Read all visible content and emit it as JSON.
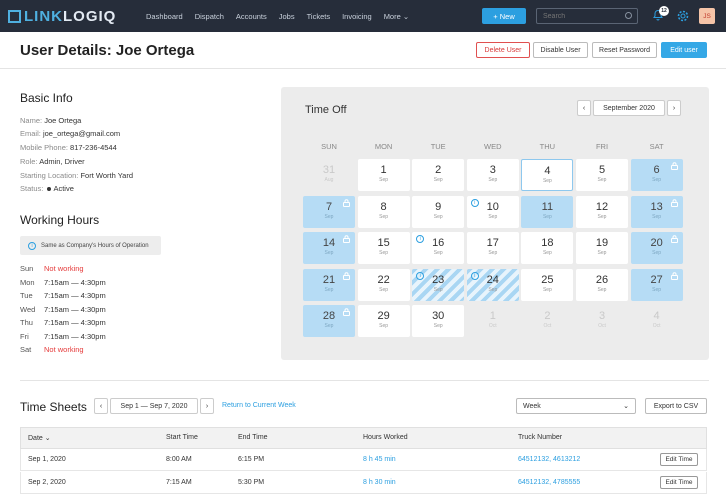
{
  "nav": {
    "logo_a": "LINK",
    "logo_b": "LOGIQ",
    "links": [
      "Dashboard",
      "Dispatch",
      "Accounts",
      "Jobs",
      "Tickets",
      "Invoicing",
      "More"
    ],
    "new_label": "+ New",
    "search_placeholder": "Search",
    "notification_count": "12",
    "avatar_initials": "JS"
  },
  "header": {
    "title": "User Details: Joe Ortega",
    "delete_label": "Delete User",
    "disable_label": "Disable User",
    "reset_label": "Reset Password",
    "edit_label": "Edit user"
  },
  "basic_info": {
    "title": "Basic Info",
    "rows": [
      {
        "label": "Name:",
        "value": "Joe Ortega"
      },
      {
        "label": "Email:",
        "value": "joe_ortega@gmail.com"
      },
      {
        "label": "Mobile Phone:",
        "value": "817-236-4544"
      },
      {
        "label": "Role:",
        "value": "Admin, Driver"
      },
      {
        "label": "Starting Location:",
        "value": "Fort Worth Yard"
      },
      {
        "label": "Status:",
        "value": "Active"
      }
    ]
  },
  "working_hours": {
    "title": "Working Hours",
    "note": "Same as Company's Hours of Operation",
    "days": [
      {
        "day": "Sun",
        "hours": "Not working",
        "off": true
      },
      {
        "day": "Mon",
        "hours": "7:15am — 4:30pm",
        "off": false
      },
      {
        "day": "Tue",
        "hours": "7:15am — 4:30pm",
        "off": false
      },
      {
        "day": "Wed",
        "hours": "7:15am — 4:30pm",
        "off": false
      },
      {
        "day": "Thu",
        "hours": "7:15am — 4:30pm",
        "off": false
      },
      {
        "day": "Fri",
        "hours": "7:15am — 4:30pm",
        "off": false
      },
      {
        "day": "Sat",
        "hours": "Not working",
        "off": true
      }
    ]
  },
  "time_off": {
    "title": "Time Off",
    "month_label": "September 2020",
    "weekdays": [
      "SUN",
      "MON",
      "TUE",
      "WED",
      "THU",
      "FRI",
      "SAT"
    ],
    "cells": [
      {
        "day": "31",
        "mon": "Aug",
        "style": "faint",
        "lock": false,
        "info": false
      },
      {
        "day": "1",
        "mon": "Sep",
        "style": "white",
        "lock": false,
        "info": false
      },
      {
        "day": "2",
        "mon": "Sep",
        "style": "white",
        "lock": false,
        "info": false
      },
      {
        "day": "3",
        "mon": "Sep",
        "style": "white",
        "lock": false,
        "info": false
      },
      {
        "day": "4",
        "mon": "Sep",
        "style": "today",
        "lock": false,
        "info": false
      },
      {
        "day": "5",
        "mon": "Sep",
        "style": "white",
        "lock": false,
        "info": false
      },
      {
        "day": "6",
        "mon": "Sep",
        "style": "blue",
        "lock": true,
        "info": false
      },
      {
        "day": "7",
        "mon": "Sep",
        "style": "blue",
        "lock": true,
        "info": false
      },
      {
        "day": "8",
        "mon": "Sep",
        "style": "white",
        "lock": false,
        "info": false
      },
      {
        "day": "9",
        "mon": "Sep",
        "style": "white",
        "lock": false,
        "info": false
      },
      {
        "day": "10",
        "mon": "Sep",
        "style": "white",
        "lock": false,
        "info": true
      },
      {
        "day": "11",
        "mon": "Sep",
        "style": "blue",
        "lock": false,
        "info": false
      },
      {
        "day": "12",
        "mon": "Sep",
        "style": "white",
        "lock": false,
        "info": false
      },
      {
        "day": "13",
        "mon": "Sep",
        "style": "blue",
        "lock": true,
        "info": false
      },
      {
        "day": "14",
        "mon": "Sep",
        "style": "blue",
        "lock": true,
        "info": false
      },
      {
        "day": "15",
        "mon": "Sep",
        "style": "white",
        "lock": false,
        "info": false
      },
      {
        "day": "16",
        "mon": "Sep",
        "style": "white",
        "lock": false,
        "info": true
      },
      {
        "day": "17",
        "mon": "Sep",
        "style": "white",
        "lock": false,
        "info": false
      },
      {
        "day": "18",
        "mon": "Sep",
        "style": "white",
        "lock": false,
        "info": false
      },
      {
        "day": "19",
        "mon": "Sep",
        "style": "white",
        "lock": false,
        "info": false
      },
      {
        "day": "20",
        "mon": "Sep",
        "style": "blue",
        "lock": true,
        "info": false
      },
      {
        "day": "21",
        "mon": "Sep",
        "style": "blue",
        "lock": true,
        "info": false
      },
      {
        "day": "22",
        "mon": "Sep",
        "style": "white",
        "lock": false,
        "info": false
      },
      {
        "day": "23",
        "mon": "Sep",
        "style": "striped",
        "lock": false,
        "info": true
      },
      {
        "day": "24",
        "mon": "Sep",
        "style": "striped",
        "lock": false,
        "info": true
      },
      {
        "day": "25",
        "mon": "Sep",
        "style": "white",
        "lock": false,
        "info": false
      },
      {
        "day": "26",
        "mon": "Sep",
        "style": "white",
        "lock": false,
        "info": false
      },
      {
        "day": "27",
        "mon": "Sep",
        "style": "blue",
        "lock": true,
        "info": false
      },
      {
        "day": "28",
        "mon": "Sep",
        "style": "blue",
        "lock": true,
        "info": false
      },
      {
        "day": "29",
        "mon": "Sep",
        "style": "white",
        "lock": false,
        "info": false
      },
      {
        "day": "30",
        "mon": "Sep",
        "style": "white",
        "lock": false,
        "info": false
      },
      {
        "day": "1",
        "mon": "Oct",
        "style": "faint",
        "lock": false,
        "info": false
      },
      {
        "day": "2",
        "mon": "Oct",
        "style": "faint",
        "lock": false,
        "info": false
      },
      {
        "day": "3",
        "mon": "Oct",
        "style": "faint",
        "lock": false,
        "info": false
      },
      {
        "day": "4",
        "mon": "Oct",
        "style": "faint",
        "lock": false,
        "info": false
      }
    ]
  },
  "time_sheets": {
    "title": "Time Sheets",
    "range_label": "Sep 1 — Sep 7, 2020",
    "return_label": "Return to Current Week",
    "period_select": "Week",
    "export_label": "Export to CSV",
    "columns": [
      "Date",
      "Start Time",
      "End Time",
      "Hours Worked",
      "Truck Number"
    ],
    "rows": [
      {
        "date": "Sep 1, 2020",
        "start": "8:00 AM",
        "end": "6:15 PM",
        "hours": "8 h 45 min",
        "truck": "64512132, 4613212",
        "action": "Edit Time"
      },
      {
        "date": "Sep 2, 2020",
        "start": "7:15 AM",
        "end": "5:30 PM",
        "hours": "8 h 30 min",
        "truck": "64512132, 4785555",
        "action": "Edit Time"
      }
    ]
  },
  "colors": {
    "nav_bg": "#262d3a",
    "accent": "#2c9fe0",
    "danger": "#e53b3b",
    "time_off_blue": "#b6dcf5"
  }
}
